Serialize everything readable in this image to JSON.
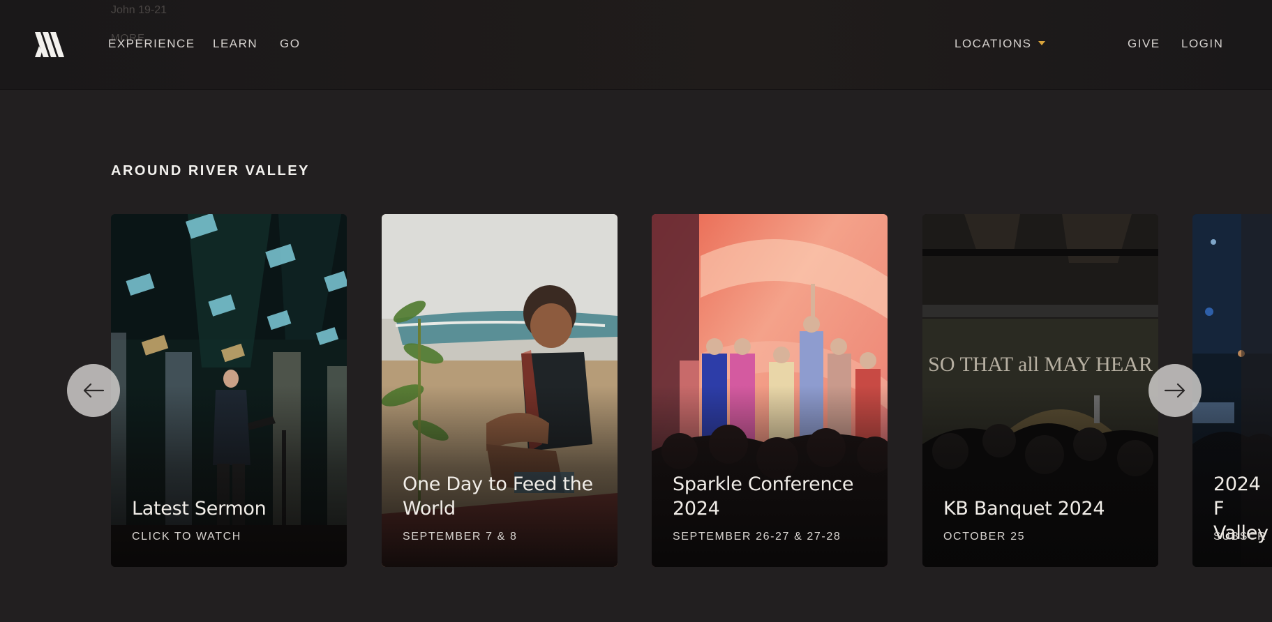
{
  "header": {
    "background_text": {
      "scripture_ref": "John 19-21",
      "more_label": "MORE"
    },
    "nav_left": [
      "EXPERIENCE",
      "LEARN",
      "GO"
    ],
    "locations_label": "LOCATIONS",
    "give_label": "GIVE",
    "login_label": "LOGIN",
    "accent_color": "#d9a43c"
  },
  "section": {
    "title": "AROUND RIVER VALLEY",
    "cards": [
      {
        "title": "Latest Sermon",
        "subtitle": "CLICK TO WATCH",
        "image": "pastor preaching on stage"
      },
      {
        "title": "One Day to Feed the World",
        "subtitle": "SEPTEMBER 7 & 8",
        "image": "child eating on beach"
      },
      {
        "title": "Sparkle Conference 2024",
        "subtitle": "SEPTEMBER 26-27 & 27-28",
        "image": "women singing on stage"
      },
      {
        "title": "KB Banquet 2024",
        "subtitle": "OCTOBER 25",
        "image": "banquet hall with screen",
        "screen_text": "SO THAT all MAY HEAR"
      },
      {
        "title": "2024 F Valley",
        "subtitle": "SUBSCR",
        "image": "concert crowd"
      }
    ],
    "prev_icon": "arrow-left-icon",
    "next_icon": "arrow-right-icon"
  }
}
